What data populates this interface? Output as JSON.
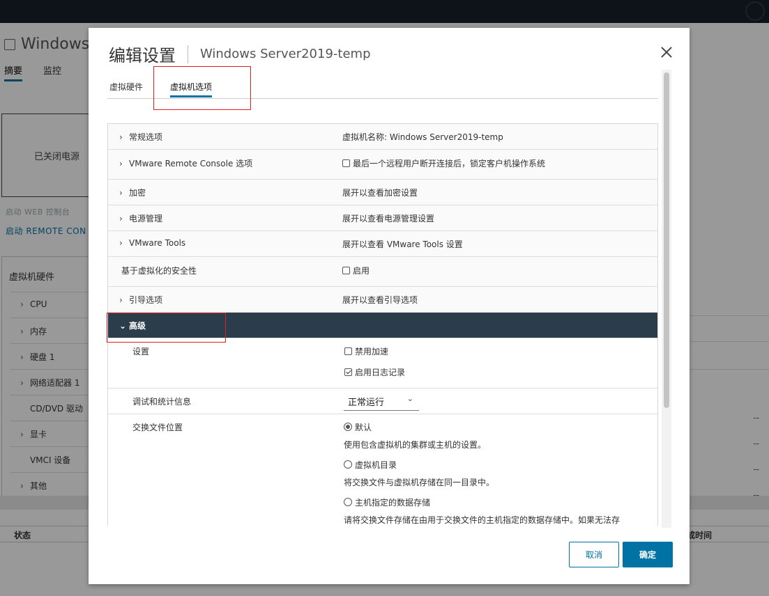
{
  "background": {
    "vm_name": "Windows",
    "tabs": [
      "摘要",
      "监控"
    ],
    "power_state": "已关闭电源",
    "launch_web_console": "启动 WEB 控制台",
    "launch_remote_console": "启动 REMOTE CON",
    "hardware_title": "虚拟机硬件",
    "hardware_items": [
      "CPU",
      "内存",
      "硬盘 1",
      "网络适配器 1",
      "CD/DVD 驱动",
      "显卡",
      "VMCI 设备",
      "其他"
    ],
    "right_dashes": [
      "--",
      "--",
      "--",
      "--"
    ],
    "status_header": "状态",
    "completion_time_header": "成时间"
  },
  "dialog": {
    "title": "编辑设置",
    "subtitle": "Windows Server2019-temp",
    "tabs": {
      "hardware": "虚拟硬件",
      "options": "虚拟机选项"
    },
    "rows": {
      "general": {
        "label": "常规选项",
        "value": "虚拟机名称: Windows Server2019-temp"
      },
      "vmrc": {
        "label": "VMware Remote Console 选项",
        "value": "最后一个远程用户断开连接后，锁定客户机操作系统"
      },
      "encryption": {
        "label": "加密",
        "value": "展开以查看加密设置"
      },
      "power": {
        "label": "电源管理",
        "value": "展开以查看电源管理设置"
      },
      "tools": {
        "label": "VMware Tools",
        "value": "展开以查看 VMware Tools 设置"
      },
      "vbs": {
        "label": "基于虚拟化的安全性",
        "value": "启用"
      },
      "boot": {
        "label": "引导选项",
        "value": "展开以查看引导选项"
      },
      "advanced": {
        "label": "高级"
      }
    },
    "advanced": {
      "settings_label": "设置",
      "disable_accel": "禁用加速",
      "enable_logging": "启用日志记录",
      "debug_label": "调试和统计信息",
      "debug_value": "正常运行",
      "swap_label": "交换文件位置",
      "swap_default": "默认",
      "swap_default_desc": "使用包含虚拟机的集群或主机的设置。",
      "swap_vmdir": "虚拟机目录",
      "swap_vmdir_desc": "将交换文件与虚拟机存储在同一目录中。",
      "swap_host": "主机指定的数据存储",
      "swap_host_desc": "请将交换文件存储在由用于交换文件的主机指定的数据存储中。如果无法存"
    },
    "buttons": {
      "cancel": "取消",
      "ok": "确定"
    }
  }
}
